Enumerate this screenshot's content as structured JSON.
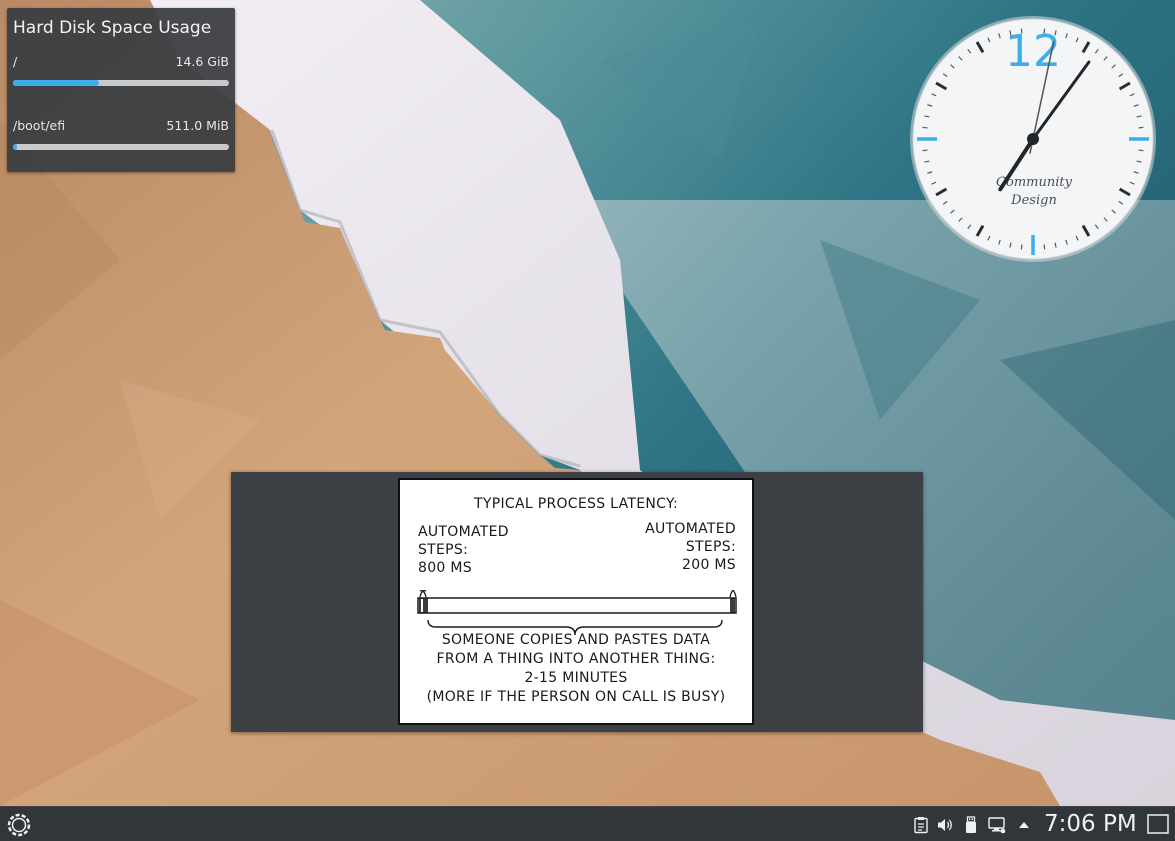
{
  "disk_widget": {
    "title": "Hard Disk Space Usage",
    "entries": [
      {
        "mount": "/",
        "size": "14.6 GiB",
        "usage_fraction": 0.4
      },
      {
        "mount": "/boot/efi",
        "size": "511.0 MiB",
        "usage_fraction": 0.02
      }
    ],
    "bar_color": "#3daee9",
    "track_color": "#c7cacd"
  },
  "clock_widget": {
    "hour_label": "12",
    "brand_line1": "Community",
    "brand_line2": "Design",
    "time_shown": {
      "hour": 7,
      "minute": 6
    },
    "accent": "#3daee9"
  },
  "comic": {
    "title": "TYPICAL PROCESS LATENCY:",
    "left_label": "AUTOMATED\nSTEPS:\n800 MS",
    "right_label": "AUTOMATED\nSTEPS:\n200 MS",
    "bottom_text": "SOMEONE COPIES AND PASTES DATA\nFROM A THING INTO ANOTHER THING:\n2-15 MINUTES\n(MORE IF THE PERSON ON CALL IS BUSY)"
  },
  "taskbar": {
    "launcher_icon": "plasma-launcher-icon",
    "tray_icons": [
      "clipboard-icon",
      "volume-icon",
      "usb-device-icon",
      "network-icon",
      "expand-tray-icon"
    ],
    "time": "7:06 PM",
    "show_desktop_icon": "show-desktop-icon",
    "background": "#31363b"
  }
}
